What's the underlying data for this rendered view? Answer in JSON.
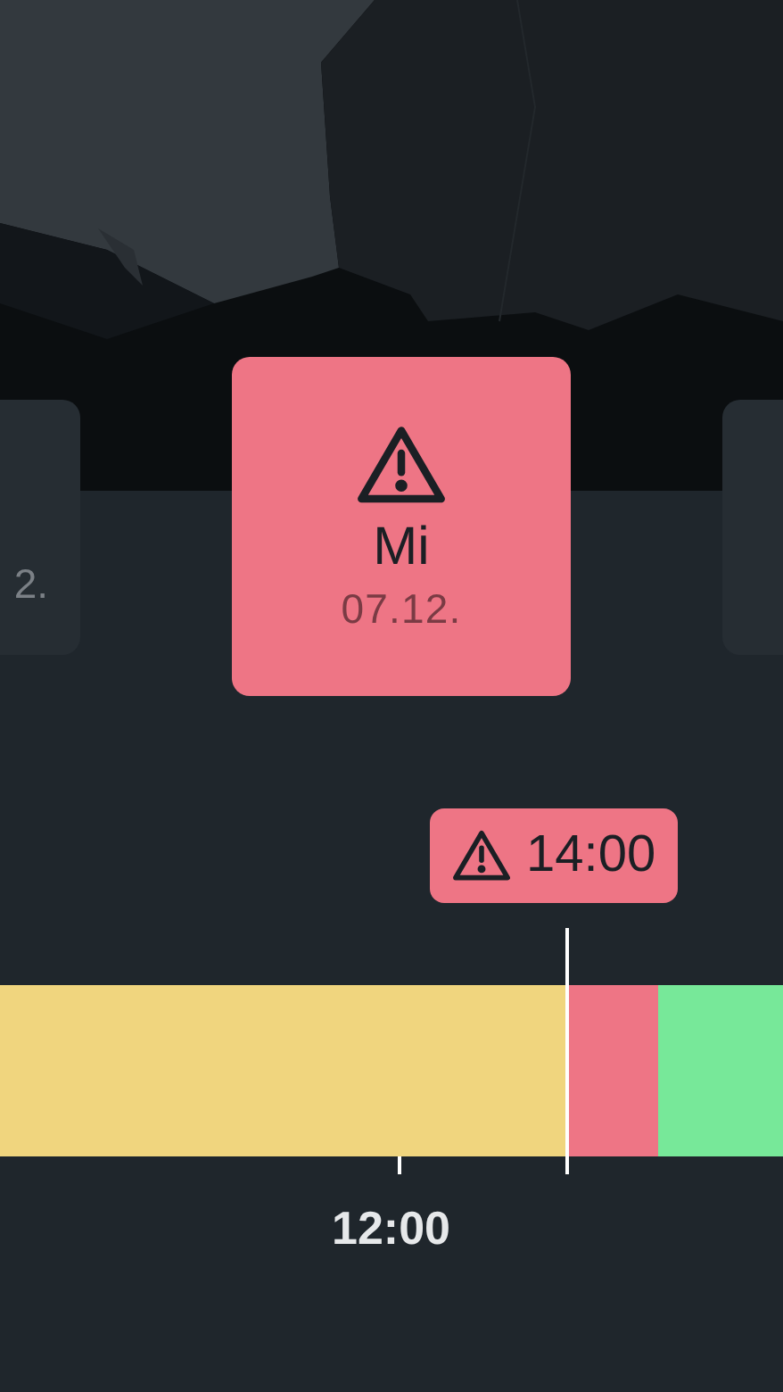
{
  "days": [
    {
      "date": "2.",
      "selected": false
    },
    {
      "day": "Mi",
      "date": "07.12.",
      "selected": true,
      "warning": true
    },
    {
      "selected": false
    }
  ],
  "timeline": {
    "marker": {
      "time": "14:00",
      "warning": true
    },
    "segments": [
      {
        "color": "#f0d57e"
      },
      {
        "color": "#ee7585"
      },
      {
        "color": "#77e899"
      }
    ],
    "ticks": [
      "12:00"
    ]
  }
}
